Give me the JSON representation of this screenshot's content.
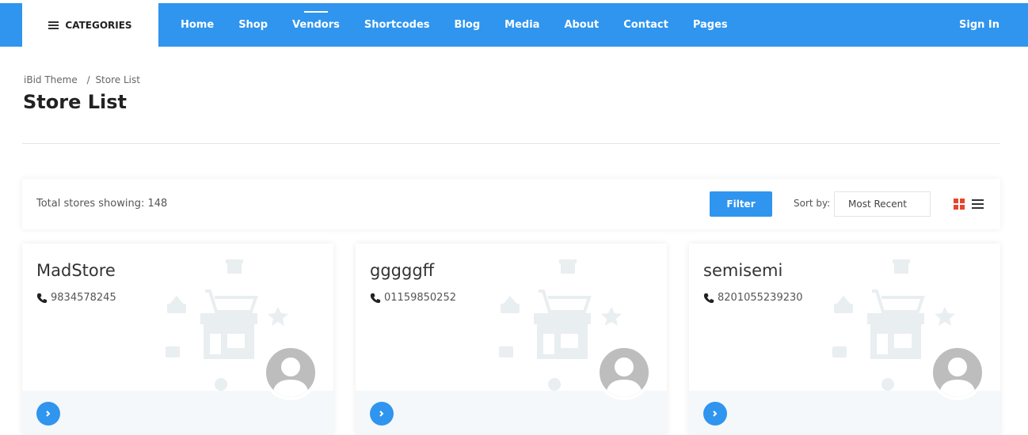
{
  "header": {
    "categories_label": "CATEGORIES",
    "nav": [
      "Home",
      "Shop",
      "Vendors",
      "Shortcodes",
      "Blog",
      "Media",
      "About",
      "Contact",
      "Pages"
    ],
    "active_nav": "Vendors",
    "signin_label": "Sign In",
    "accent_color": "#2f95ee"
  },
  "breadcrumb": {
    "home": "iBid Theme",
    "separator": "/",
    "current": "Store List"
  },
  "page_title": "Store List",
  "toolbar": {
    "total_label": "Total stores showing: 148",
    "filter_label": "Filter",
    "sort_label": "Sort by:",
    "sort_value": "Most Recent",
    "view_grid_icon": "grid-icon",
    "view_list_icon": "list-icon"
  },
  "stores": [
    {
      "name": "MadStore",
      "phone": "9834578245"
    },
    {
      "name": "gggggff",
      "phone": "01159850252"
    },
    {
      "name": "semisemi",
      "phone": "8201055239230"
    }
  ]
}
